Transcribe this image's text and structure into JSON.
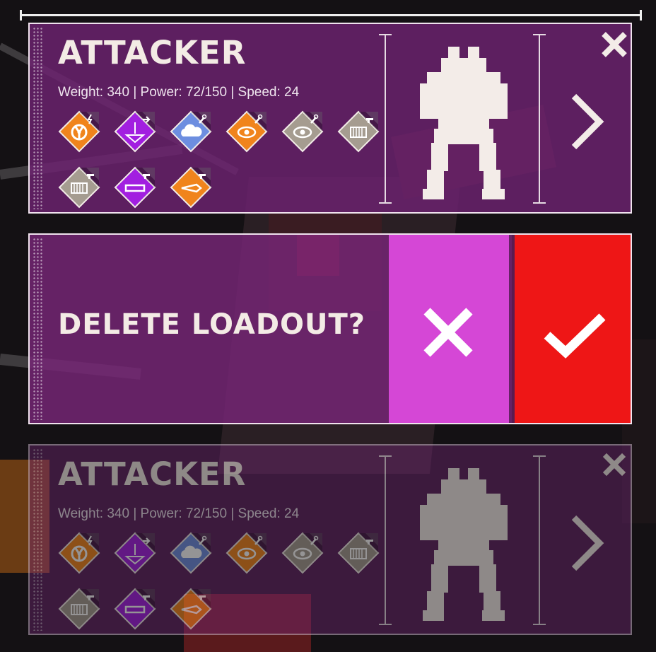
{
  "loadouts": [
    {
      "name": "ATTACKER",
      "stats": "Weight: 340 | Power: 72/150 | Speed: 24",
      "modules": [
        {
          "icon": "radiation-icon",
          "color": "#f0841c",
          "badge": "bolt"
        },
        {
          "icon": "gravity-icon",
          "color": "#a21fe0",
          "badge": "arrow"
        },
        {
          "icon": "cloud-icon",
          "color": "#6d8ee0",
          "badge": "wrench"
        },
        {
          "icon": "eye-icon",
          "color": "#f0841c",
          "badge": "wrench"
        },
        {
          "icon": "eye-icon",
          "color": "#a59c90",
          "badge": "wrench"
        },
        {
          "icon": "armor-plate-icon",
          "color": "#a59c90",
          "badge": "gun"
        },
        {
          "icon": "armor-plate-icon",
          "color": "#a59c90",
          "badge": "gun"
        },
        {
          "icon": "bar-icon",
          "color": "#a21fe0",
          "badge": "gun"
        },
        {
          "icon": "missile-icon",
          "color": "#f0841c",
          "badge": "gun"
        }
      ]
    },
    {
      "name": "ATTACKER",
      "stats": "Weight: 340 | Power: 72/150 | Speed: 24"
    }
  ],
  "delete_prompt": {
    "text": "DELETE LOADOUT?",
    "cancel_color": "#d547d6",
    "confirm_color": "#ee1616"
  }
}
